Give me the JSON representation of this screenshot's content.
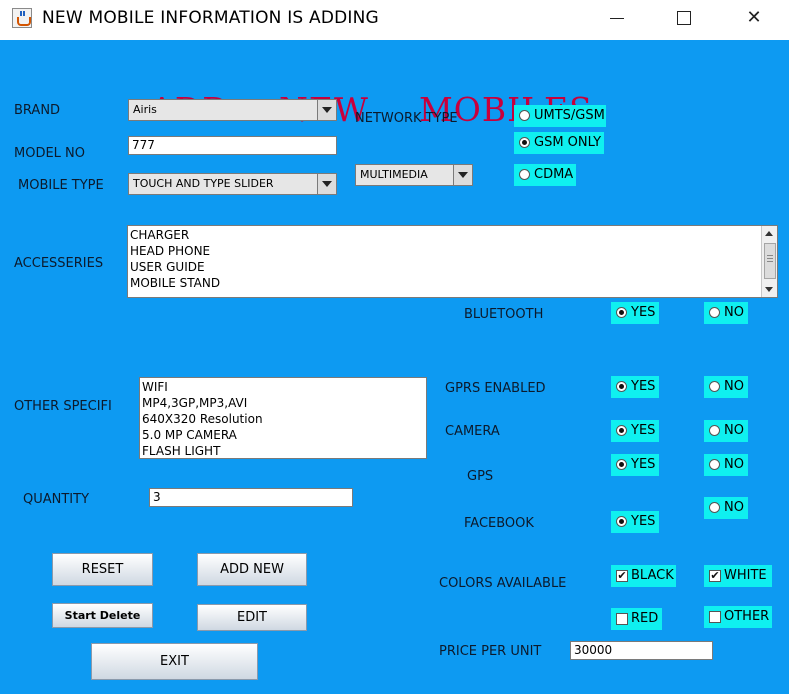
{
  "window": {
    "title": "NEW MOBILE INFORMATION IS ADDING",
    "min_icon": "minimize-icon",
    "max_icon": "maximize-icon",
    "close_icon": "close-icon",
    "close_glyph": "✕"
  },
  "heading": {
    "word1": "ADD",
    "word2": "NEW",
    "word3": "MOBILES"
  },
  "labels": {
    "brand": "BRAND",
    "model_no": "MODEL NO",
    "mobile_type": "MOBILE TYPE",
    "network_type": "NETWORK TYPE",
    "accessories": "ACCESSERIES",
    "bluetooth": "BLUETOOTH",
    "other_spec": "OTHER SPECIFI",
    "gprs": "GPRS ENABLED",
    "camera": "CAMERA",
    "gps": "GPS",
    "facebook": "FACEBOOK",
    "quantity": "QUANTITY",
    "colors": "COLORS AVAILABLE",
    "price": "PRICE PER UNIT"
  },
  "fields": {
    "brand": "Airis",
    "model_no": "777",
    "mobile_type": "TOUCH AND TYPE SLIDER",
    "category": "MULTIMEDIA",
    "quantity": "3",
    "price": "30000"
  },
  "network": {
    "umts": {
      "label": "UMTS/GSM",
      "selected": false
    },
    "gsm": {
      "label": "GSM ONLY",
      "selected": true
    },
    "cdma": {
      "label": "CDMA",
      "selected": false
    }
  },
  "accessories": [
    "CHARGER",
    "HEAD PHONE",
    "USER GUIDE",
    "MOBILE STAND"
  ],
  "other_spec": [
    "WIFI",
    "MP4,3GP,MP3,AVI",
    "640X320 Resolution",
    "5.0 MP CAMERA",
    "FLASH LIGHT"
  ],
  "yes_no": {
    "yes": "YES",
    "no": "NO"
  },
  "colors": {
    "black": {
      "label": "BLACK",
      "checked": true
    },
    "white": {
      "label": "WHITE",
      "checked": true
    },
    "red": {
      "label": "RED",
      "checked": false
    },
    "other": {
      "label": "OTHER",
      "checked": false
    },
    "check_glyph": "✔"
  },
  "buttons": {
    "reset": "RESET",
    "add_new": "ADD NEW",
    "start_delete": "Start Delete",
    "edit": "EDIT",
    "exit": "EXIT"
  },
  "theme": {
    "panel": "#0d9af2",
    "option_bg": "#0ff0f0",
    "heading": "#c8003c"
  }
}
